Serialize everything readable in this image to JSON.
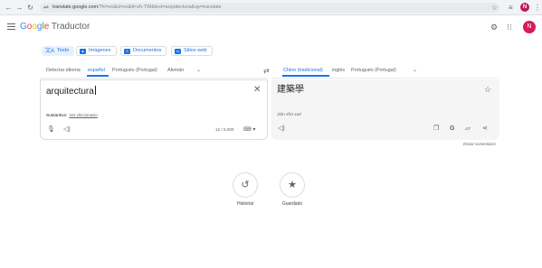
{
  "browser": {
    "url_host": "translate.google.com",
    "url_rest": "/?hl=es&sl=es&tl=zh-TW&text=arquitectura&op=translate"
  },
  "app": {
    "logo": {
      "g1": "G",
      "g2": "o",
      "g3": "o",
      "g4": "g",
      "g5": "l",
      "g6": "e",
      "sub": "Traductor"
    },
    "avatar_initial": "N"
  },
  "modes": [
    {
      "label": "Texto"
    },
    {
      "label": "Imágenes"
    },
    {
      "label": "Documentos"
    },
    {
      "label": "Sitios web"
    }
  ],
  "source_langs": [
    "Detectar idioma",
    "español",
    "Portugués (Portugal)",
    "Alemán"
  ],
  "target_langs": [
    "Chino (tradicional)",
    "inglés",
    "Portugués (Portugal)"
  ],
  "source": {
    "text": "arquitectura",
    "dict_pos": "Sustantivo",
    "dict_link": "Ver diccionario",
    "char_count": "12 / 5.000"
  },
  "target": {
    "text": "建築學",
    "romanization": "Jiàn zhù xué"
  },
  "feedback": "Enviar comentarios",
  "history_label": "Historial",
  "saved_label": "Guardado",
  "colors": {
    "accent": "#1a73e8",
    "avatar": "#d81b60"
  }
}
